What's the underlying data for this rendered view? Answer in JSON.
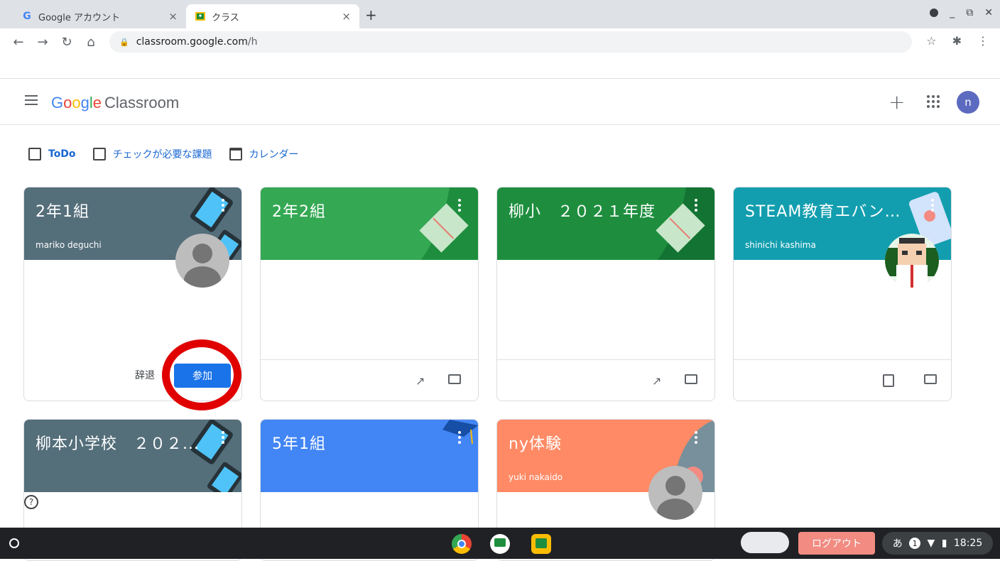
{
  "browser": {
    "tabs": [
      {
        "title": "Google アカウント",
        "favicon": "G",
        "close": "×"
      },
      {
        "title": "クラス",
        "favicon": "classroom-icon",
        "close": "×"
      }
    ],
    "new_tab": "+",
    "url_host": "classroom.google.com",
    "url_path": "/h"
  },
  "app": {
    "logo_google": [
      "G",
      "o",
      "o",
      "g",
      "l",
      "e"
    ],
    "logo_product": "Classroom",
    "plus": "+",
    "avatar_letter": "n"
  },
  "links": [
    {
      "label": "ToDo"
    },
    {
      "label": "チェックが必要な課題"
    },
    {
      "label": "カレンダー"
    }
  ],
  "cards": [
    {
      "title": "2年1組",
      "teacher": "mariko deguchi",
      "color": "#546e7a",
      "decline": "辞退",
      "join": "参加"
    },
    {
      "title": "2年2組",
      "teacher": "",
      "color": "#34a853"
    },
    {
      "title": "柳小　２０２１年度",
      "teacher": "",
      "color": "#1e8e3e"
    },
    {
      "title": "STEAM教育エバンジ...",
      "teacher": "shinichi kashima",
      "color": "#129eaf"
    },
    {
      "title": "柳本小学校　２０２...",
      "teacher": "",
      "color": "#546e7a"
    },
    {
      "title": "5年1組",
      "teacher": "",
      "color": "#4285f4"
    },
    {
      "title": "ny体験",
      "teacher": "yuki nakaido",
      "color": "#ff8a65"
    }
  ],
  "shelf": {
    "logout": "ログアウト",
    "ime": "あ",
    "notifications": "1",
    "time": "18:25"
  }
}
